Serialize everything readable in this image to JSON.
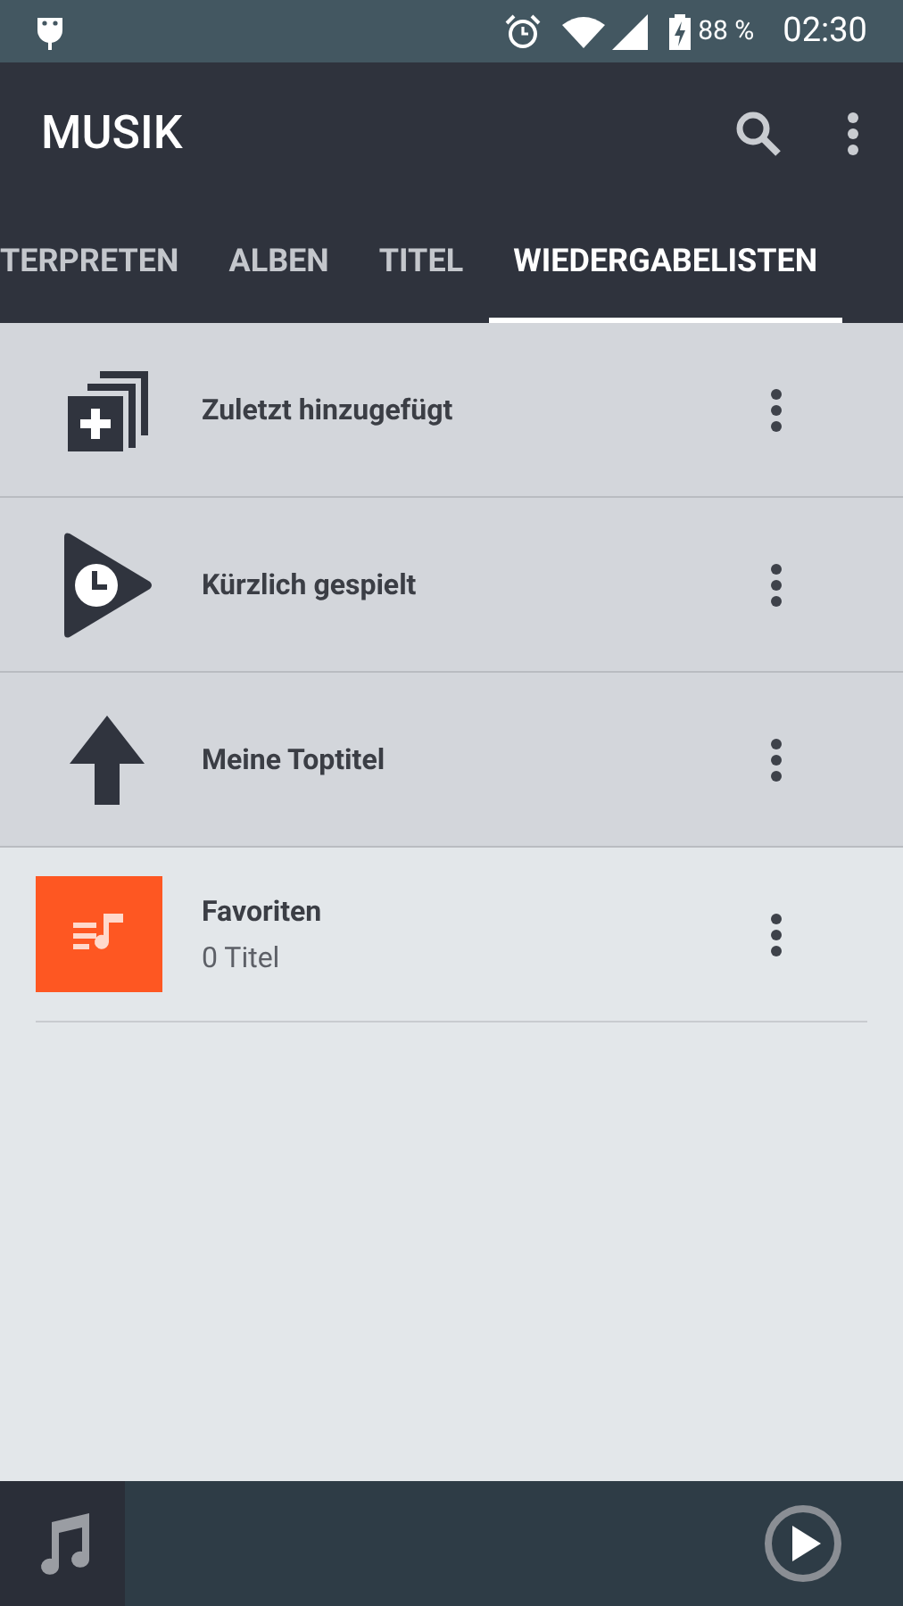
{
  "status_bar": {
    "battery": "88 %",
    "time": "02:30"
  },
  "toolbar": {
    "title": "MUSIK"
  },
  "tabs": [
    {
      "label": "TERPRETEN",
      "selected": false
    },
    {
      "label": "ALBEN",
      "selected": false
    },
    {
      "label": "TITEL",
      "selected": false
    },
    {
      "label": "WIEDERGABELISTEN",
      "selected": true
    }
  ],
  "playlists": [
    {
      "kind": "recent-added",
      "title": "Zuletzt hinzugefügt"
    },
    {
      "kind": "recent-played",
      "title": "Kürzlich gespielt"
    },
    {
      "kind": "top",
      "title": "Meine Toptitel"
    },
    {
      "kind": "user",
      "title": "Favoriten",
      "subtitle": "0 Titel"
    }
  ]
}
